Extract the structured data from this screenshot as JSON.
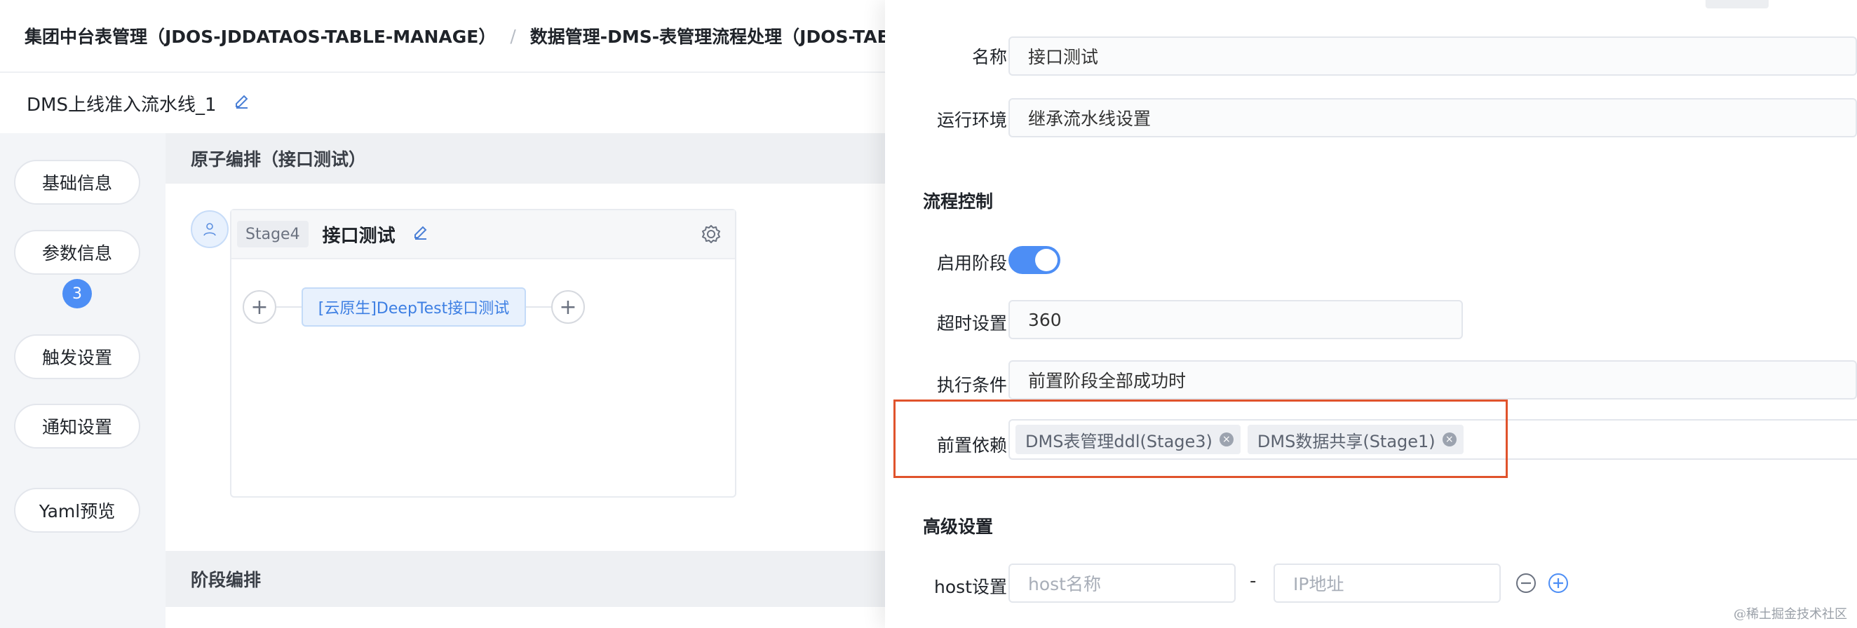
{
  "breadcrumb": {
    "item1": "集团中台表管理（JDOS-JDDATAOS-TABLE-MANAGE）",
    "separator": "/",
    "item2": "数据管理-DMS-表管理流程处理（JDOS-TABLE"
  },
  "pipeline": {
    "title": "DMS上线准入流水线_1"
  },
  "leftnav": {
    "items": [
      {
        "label": "基础信息"
      },
      {
        "label": "参数信息"
      },
      {
        "label": "触发设置"
      },
      {
        "label": "通知设置"
      },
      {
        "label": "Yaml预览"
      }
    ],
    "params_badge": "3"
  },
  "main": {
    "atomic_section_title": "原子编排（接口测试）",
    "stage": {
      "tag": "Stage4",
      "name": "接口测试",
      "task_label": "[云原生]DeepTest接口测试",
      "add_symbol": "+"
    },
    "stage_section_title": "阶段编排"
  },
  "drawer": {
    "name_label": "名称",
    "name_value": "接口测试",
    "env_label": "运行环境",
    "env_value": "继承流水线设置",
    "flow_control_title": "流程控制",
    "enable_stage_label": "启用阶段",
    "enable_stage_on": true,
    "timeout_label": "超时设置",
    "timeout_value": "360",
    "condition_label": "执行条件",
    "condition_value": "前置阶段全部成功时",
    "dependency_label": "前置依赖",
    "dependencies": [
      "DMS表管理ddl(Stage3)",
      "DMS数据共享(Stage1)"
    ],
    "advanced_title": "高级设置",
    "host_label": "host设置",
    "host_placeholder": "host名称",
    "host_dash": "-",
    "ip_placeholder": "IP地址"
  },
  "colors": {
    "accent": "#4d8ef5",
    "highlight_border": "#e0532c",
    "task_text": "#3d7fe3"
  },
  "watermark": "@稀土掘金技术社区"
}
